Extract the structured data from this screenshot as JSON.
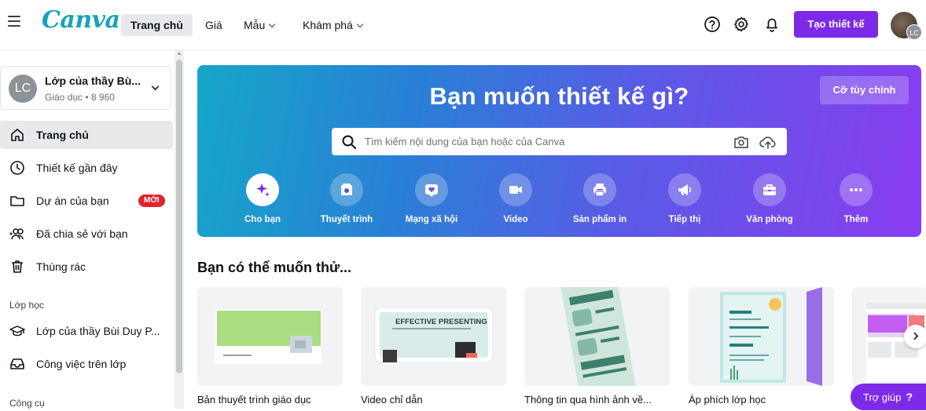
{
  "header": {
    "logo": "Canva",
    "nav": [
      {
        "label": "Trang chủ",
        "active": true
      },
      {
        "label": "Giá"
      },
      {
        "label": "Mẫu",
        "dropdown": true
      },
      {
        "label": "Khám phá",
        "dropdown": true
      }
    ],
    "create_button": "Tạo thiết kế",
    "avatar_initials": "LC",
    "icons": [
      "help-icon",
      "settings-icon",
      "bell-icon"
    ]
  },
  "sidebar": {
    "team": {
      "initials": "LC",
      "name": "Lớp của thầy Bù...",
      "subtitle": "Giáo dục • 8 960"
    },
    "items": [
      {
        "label": "Trang chủ",
        "icon": "home-icon",
        "active": true
      },
      {
        "label": "Thiết kế gần đây",
        "icon": "clock-icon"
      },
      {
        "label": "Dự án của bạn",
        "icon": "folder-icon",
        "badge": "MỚI"
      },
      {
        "label": "Đã chia sẻ với bạn",
        "icon": "shared-users-icon"
      },
      {
        "label": "Thùng rác",
        "icon": "trash-icon"
      }
    ],
    "section_class": "Lớp học",
    "class_items": [
      {
        "label": "Lớp của thầy Bùi Duy P...",
        "icon": "graduation-cap-icon"
      },
      {
        "label": "Công việc trên lớp",
        "icon": "inbox-icon"
      }
    ],
    "section_tools": "Công cụ"
  },
  "hero": {
    "title": "Bạn muốn thiết kế gì?",
    "custom_size": "Cỡ tùy chỉnh",
    "search_placeholder": "Tìm kiếm nội dung của bạn hoặc của Canva",
    "categories": [
      {
        "label": "Cho bạn",
        "icon": "sparkle-icon",
        "selected": true
      },
      {
        "label": "Thuyết trình",
        "icon": "presentation-icon"
      },
      {
        "label": "Mạng xã hội",
        "icon": "heart-icon"
      },
      {
        "label": "Video",
        "icon": "video-icon"
      },
      {
        "label": "Sản phẩm in",
        "icon": "printer-icon"
      },
      {
        "label": "Tiếp thị",
        "icon": "megaphone-icon"
      },
      {
        "label": "Văn phòng",
        "icon": "briefcase-icon"
      },
      {
        "label": "Thêm",
        "icon": "more-icon"
      }
    ]
  },
  "suggestions": {
    "title": "Bạn có thể muốn thử...",
    "cards": [
      {
        "label": "Bản thuyết trình giáo dục"
      },
      {
        "label": "Video chỉ dẫn",
        "thumb_text": "EFFECTIVE PRESENTING"
      },
      {
        "label": "Thông tin qua hình ảnh về..."
      },
      {
        "label": "Áp phích lớp học"
      },
      {
        "label": ""
      }
    ]
  },
  "help_button": "Trợ giúp",
  "help_mark": "?",
  "colors": {
    "accent": "#7d2ae8",
    "logo": "#16a3b7",
    "badge": "#e0232c"
  }
}
